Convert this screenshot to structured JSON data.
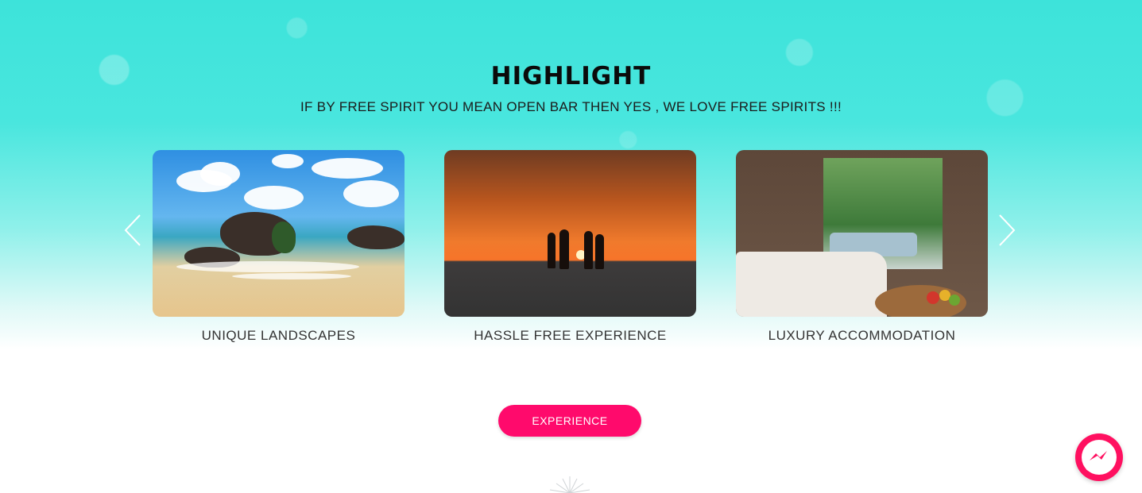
{
  "section": {
    "title": "HIGHLIGHT",
    "subtitle": "IF BY FREE SPIRIT YOU MEAN OPEN BAR THEN YES , WE LOVE FREE SPIRITS !!!"
  },
  "carousel": {
    "items": [
      {
        "caption": "UNIQUE LANDSCAPES",
        "image": "beach-rocks-photo"
      },
      {
        "caption": "HASSLE FREE EXPERIENCE",
        "image": "sunset-friends-photo"
      },
      {
        "caption": "LUXURY ACCOMMODATION",
        "image": "hotel-room-photo"
      }
    ],
    "prev_icon": "chevron-left-icon",
    "next_icon": "chevron-right-icon"
  },
  "cta": {
    "label": "EXPERIENCE"
  },
  "messenger": {
    "icon": "messenger-icon"
  },
  "colors": {
    "accent": "#ff0a6c",
    "background_top": "#3de3da",
    "text_dark": "#0b0b0b"
  }
}
